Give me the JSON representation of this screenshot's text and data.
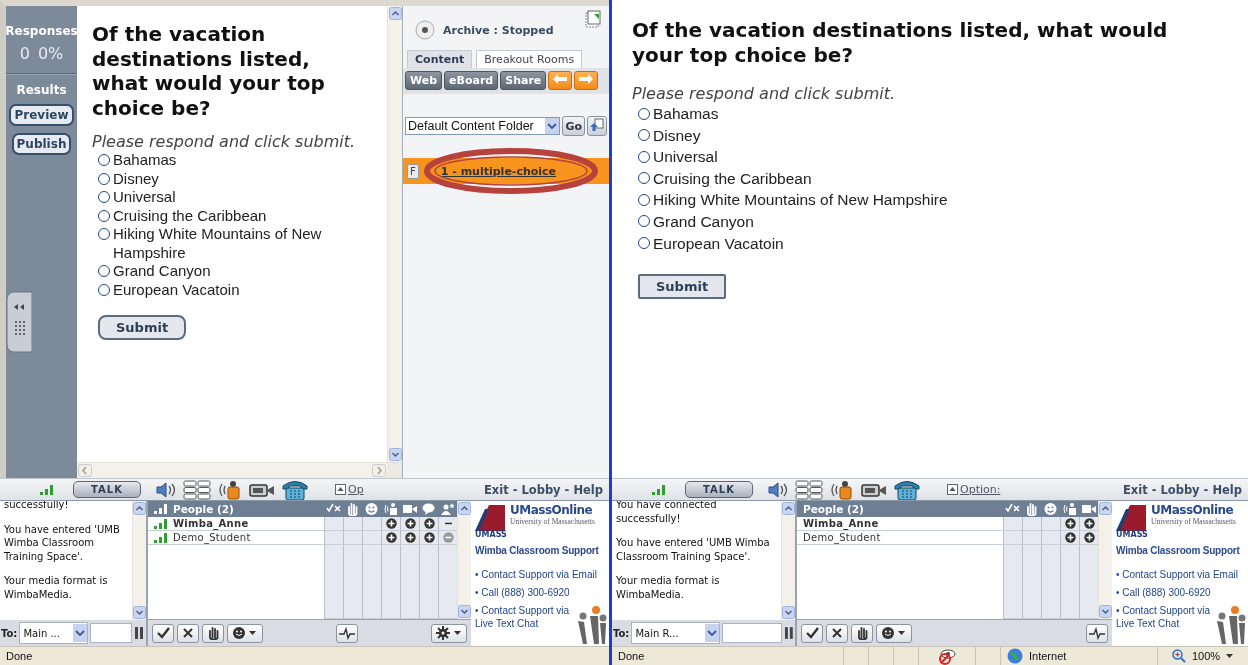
{
  "panes": [
    {
      "kind": "instructor",
      "sidebar": {
        "responses_label": "Responses",
        "response_count": "0",
        "response_percent": "0%",
        "results_label": "Results",
        "buttons": [
          "Preview",
          "Publish"
        ]
      },
      "poll": {
        "question": "Of the vacation destinations listed, what would your top choice be?",
        "instruction": "Please respond and click submit.",
        "options": [
          {
            "label": "Bahamas",
            "selected": false
          },
          {
            "label": "Disney",
            "selected": false
          },
          {
            "label": "Universal",
            "selected": false
          },
          {
            "label": "Cruising the Caribbean",
            "selected": false
          },
          {
            "label": "Hiking White Mountains of New Hampshire",
            "selected": false
          },
          {
            "label": "Grand Canyon",
            "selected": false
          },
          {
            "label": "European Vacatoin",
            "selected": false
          }
        ],
        "submit": "Submit"
      },
      "content_panel": {
        "archive_status": "Archive : Stopped",
        "tabs": [
          {
            "label": "Content",
            "selected": true
          },
          {
            "label": "Breakout Rooms",
            "selected": false
          }
        ],
        "buttons": [
          {
            "kind": "text",
            "label": "Web"
          },
          {
            "kind": "text",
            "label": "eBoard"
          },
          {
            "kind": "text",
            "label": "Share"
          },
          {
            "kind": "prev"
          },
          {
            "kind": "next"
          }
        ],
        "folder": "Default Content Folder",
        "go": "Go",
        "items": [
          {
            "button": "F",
            "label": "1 - multiple-choice",
            "selected": true,
            "circled": true
          }
        ]
      },
      "toolbar": {
        "talk": "TALK",
        "option": "Op",
        "nav": "Exit - Lobby - Help"
      },
      "chat": {
        "messages": [
          "successfully!",
          "You have entered 'UMB Wimba Classroom Training Space'.",
          "Your media format is WimbaMedia."
        ],
        "to_label": "To:",
        "recipient": "Main ..."
      },
      "people": {
        "title": "People (2)",
        "settings_menu": true,
        "rows": [
          {
            "name": "Wimba_Anne",
            "is_self": true,
            "signal": true,
            "cells": [
              {
                "kind": "empty"
              },
              {
                "kind": "empty"
              },
              {
                "kind": "empty"
              },
              {
                "kind": "plus"
              },
              {
                "kind": "plus"
              },
              {
                "kind": "plus"
              },
              {
                "kind": "dash"
              }
            ]
          },
          {
            "name": "Demo_Student",
            "is_self": false,
            "signal": true,
            "cells": [
              {
                "kind": "empty"
              },
              {
                "kind": "empty"
              },
              {
                "kind": "empty"
              },
              {
                "kind": "plus"
              },
              {
                "kind": "plus"
              },
              {
                "kind": "plus"
              },
              {
                "kind": "minus"
              }
            ]
          }
        ]
      },
      "support": {
        "brand": "UMassOnline",
        "brand_sub": "University of Massachusetts",
        "logo_text": "UMASS",
        "title": "Wimba Classroom Support",
        "links": [
          "• Contact Support via Email",
          "• Call (888) 300-6920",
          "• Contact Support via Live Text Chat"
        ]
      },
      "status_bar": {
        "text": "Done"
      }
    },
    {
      "kind": "student",
      "poll": {
        "question": "Of the vacation destinations listed, what would your top choice be?",
        "instruction": "Please respond and click submit.",
        "options": [
          {
            "label": "Bahamas",
            "selected": false
          },
          {
            "label": "Disney",
            "selected": false
          },
          {
            "label": "Universal",
            "selected": false
          },
          {
            "label": "Cruising the Caribbean",
            "selected": false
          },
          {
            "label": "Hiking White Mountains of New Hampshire",
            "selected": false
          },
          {
            "label": "Grand Canyon",
            "selected": false
          },
          {
            "label": "European Vacatoin",
            "selected": false
          }
        ],
        "submit": "Submit"
      },
      "toolbar": {
        "talk": "TALK",
        "option": "Option:",
        "nav": "Exit - Lobby - Help"
      },
      "chat": {
        "messages": [
          "You have connected successfully!",
          "You have entered 'UMB Wimba Classroom Training Space'.",
          "Your media format is WimbaMedia."
        ],
        "to_label": "To:",
        "recipient": "Main R..."
      },
      "people": {
        "title": "People (2)",
        "settings_menu": false,
        "rows": [
          {
            "name": "Wimba_Anne",
            "is_self": true,
            "signal": false,
            "cells": [
              {
                "kind": "empty"
              },
              {
                "kind": "empty"
              },
              {
                "kind": "empty"
              },
              {
                "kind": "plus"
              },
              {
                "kind": "plus"
              }
            ]
          },
          {
            "name": "Demo_Student",
            "is_self": false,
            "signal": false,
            "cells": [
              {
                "kind": "empty"
              },
              {
                "kind": "empty"
              },
              {
                "kind": "empty"
              },
              {
                "kind": "plus"
              },
              {
                "kind": "plus"
              }
            ]
          }
        ]
      },
      "support": {
        "brand": "UMassOnline",
        "brand_sub": "University of Massachusetts",
        "logo_text": "UMASS",
        "title": "Wimba Classroom Support",
        "links": [
          "• Contact Support via Email",
          "• Call (888) 300-6920",
          "• Contact Support via Live Text Chat"
        ]
      },
      "status_bar": {
        "text": "Done",
        "zone": "Internet",
        "zoom": "100%"
      }
    }
  ]
}
